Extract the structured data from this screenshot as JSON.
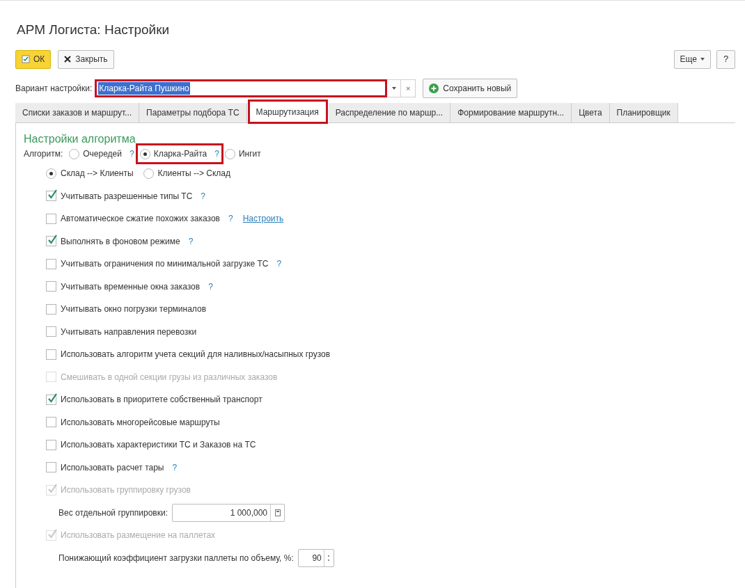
{
  "window": {
    "title": "АРМ Логиста: Настройки"
  },
  "toolbar": {
    "ok": "ОК",
    "close": "Закрыть",
    "more": "Еще",
    "help": "?"
  },
  "variant": {
    "label": "Вариант настройки:",
    "value": "Кларка-Райта Пушкино",
    "highlighted": true,
    "clear": "×",
    "save": "Сохранить новый"
  },
  "tabs": [
    {
      "label": "Списки заказов и маршрут...",
      "selected": false,
      "highlighted": false
    },
    {
      "label": "Параметры подбора ТС",
      "selected": false,
      "highlighted": false
    },
    {
      "label": "Маршрутизация",
      "selected": true,
      "highlighted": true
    },
    {
      "label": "Распределение по маршр...",
      "selected": false,
      "highlighted": false
    },
    {
      "label": "Формирование маршрутн...",
      "selected": false,
      "highlighted": false
    },
    {
      "label": "Цвета",
      "selected": false,
      "highlighted": false
    },
    {
      "label": "Планировщик",
      "selected": false,
      "highlighted": false
    }
  ],
  "section_title": "Настройки алгоритма",
  "algorithm": {
    "label": "Алгоритм:",
    "options": [
      {
        "label": "Очередей",
        "help": "?",
        "selected": false,
        "highlighted": false
      },
      {
        "label": "Кларка-Райта",
        "help": "?",
        "selected": true,
        "highlighted": true
      },
      {
        "label": "Ингит",
        "selected": false,
        "highlighted": false
      }
    ]
  },
  "settings": [
    {
      "kind": "radio_group",
      "options": [
        {
          "label": "Склад --> Клиенты",
          "selected": true
        },
        {
          "label": "Клиенты --> Склад",
          "selected": false
        }
      ]
    },
    {
      "kind": "checkbox",
      "label": "Учитывать разрешенные типы ТС",
      "help": "?",
      "checked": true,
      "disabled": false
    },
    {
      "kind": "checkbox",
      "label": "Автоматическое сжатие похожих заказов",
      "help": "?",
      "link": "Настроить",
      "checked": false,
      "disabled": false
    },
    {
      "kind": "checkbox",
      "label": "Выполнять в фоновом режиме",
      "help": "?",
      "checked": true,
      "disabled": false
    },
    {
      "kind": "checkbox",
      "label": "Учитывать ограничения по минимальной загрузке ТС",
      "help": "?",
      "checked": false,
      "disabled": false
    },
    {
      "kind": "checkbox",
      "label": "Учитывать временные окна заказов",
      "help": "?",
      "checked": false,
      "disabled": false
    },
    {
      "kind": "checkbox",
      "label": "Учитывать окно погрузки терминалов",
      "checked": false,
      "disabled": false
    },
    {
      "kind": "checkbox",
      "label": "Учитывать направления перевозки",
      "checked": false,
      "disabled": false
    },
    {
      "kind": "checkbox",
      "label": "Использовать алгоритм учета секций для наливных/насыпных грузов",
      "checked": false,
      "disabled": false
    },
    {
      "kind": "checkbox",
      "label": "Смешивать в одной секции грузы из различных заказов",
      "checked": false,
      "disabled": true
    },
    {
      "kind": "checkbox",
      "label": "Использовать в приоритете собственный транспорт",
      "checked": true,
      "disabled": false
    },
    {
      "kind": "checkbox",
      "label": "Использовать многорейсовые маршруты",
      "checked": false,
      "disabled": false
    },
    {
      "kind": "checkbox",
      "label": "Использовать характеристики ТС и Заказов на ТС",
      "checked": false,
      "disabled": false
    },
    {
      "kind": "checkbox",
      "label": "Использовать расчет тары",
      "help": "?",
      "checked": false,
      "disabled": false
    },
    {
      "kind": "checkbox",
      "label": "Использовать группировку грузов",
      "checked": true,
      "disabled": true
    },
    {
      "kind": "number_field",
      "label": "Вес отдельной группировки:",
      "value": "1 000,000"
    },
    {
      "kind": "checkbox",
      "label": "Использовать размещение на паллетах",
      "checked": true,
      "disabled": true
    },
    {
      "kind": "spin_field",
      "label": "Понижающий коэффициент загрузки паллеты по объему, %:",
      "value": "90"
    }
  ]
}
